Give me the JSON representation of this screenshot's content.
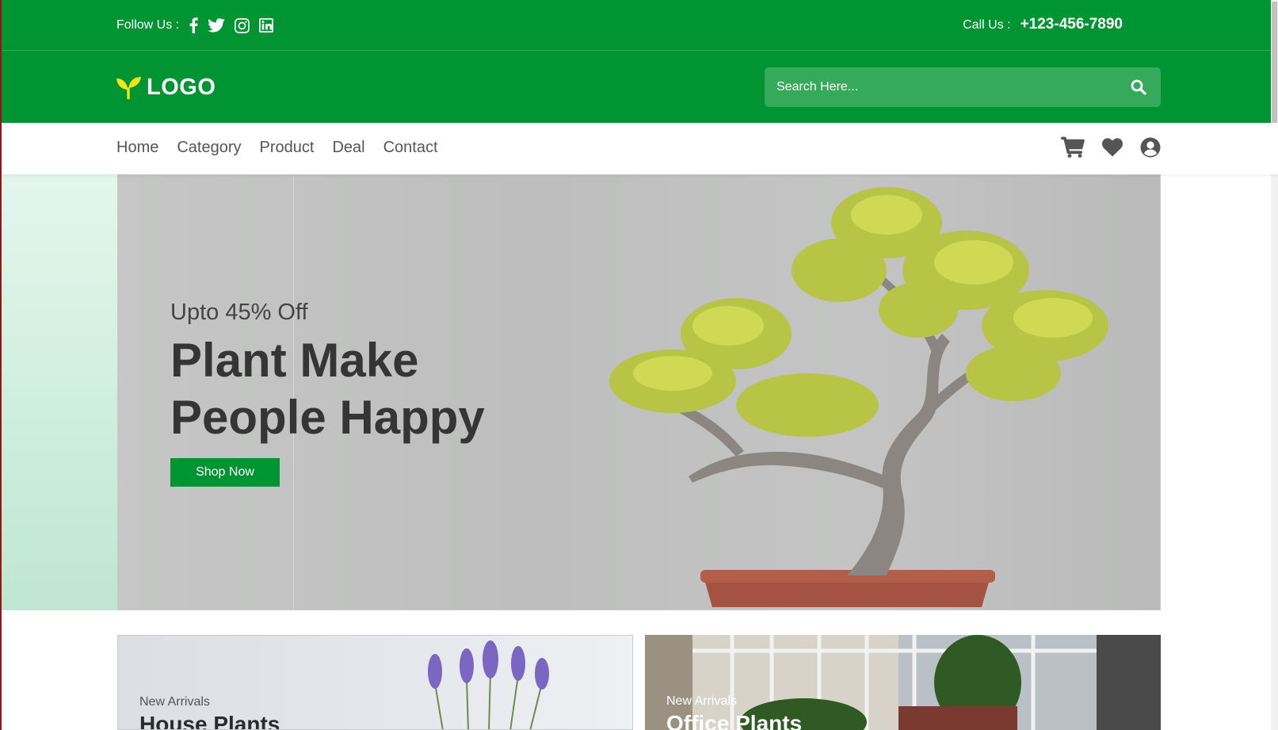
{
  "topbar": {
    "follow_label": "Follow Us :",
    "social_icons": [
      "facebook-icon",
      "twitter-icon",
      "instagram-icon",
      "linkedin-icon"
    ],
    "call_label": "Call Us :",
    "phone": "+123-456-7890"
  },
  "header": {
    "logo_text": "LOGO",
    "search_placeholder": "Search Here..."
  },
  "nav": {
    "links": [
      "Home",
      "Category",
      "Product",
      "Deal",
      "Contact"
    ],
    "icons": [
      "cart-icon",
      "heart-icon",
      "user-icon"
    ]
  },
  "hero": {
    "subtitle": "Upto 45% Off",
    "title": "Plant Make People Happy",
    "button": "Shop Now"
  },
  "cards": [
    {
      "subtitle": "New Arrivals",
      "title": "House Plants"
    },
    {
      "subtitle": "New Arrivals",
      "title": "Office Plants"
    }
  ],
  "colors": {
    "primary": "#009432",
    "search_bg": "#35aa5b",
    "text_dark": "#353535",
    "nav_text": "#555555"
  }
}
